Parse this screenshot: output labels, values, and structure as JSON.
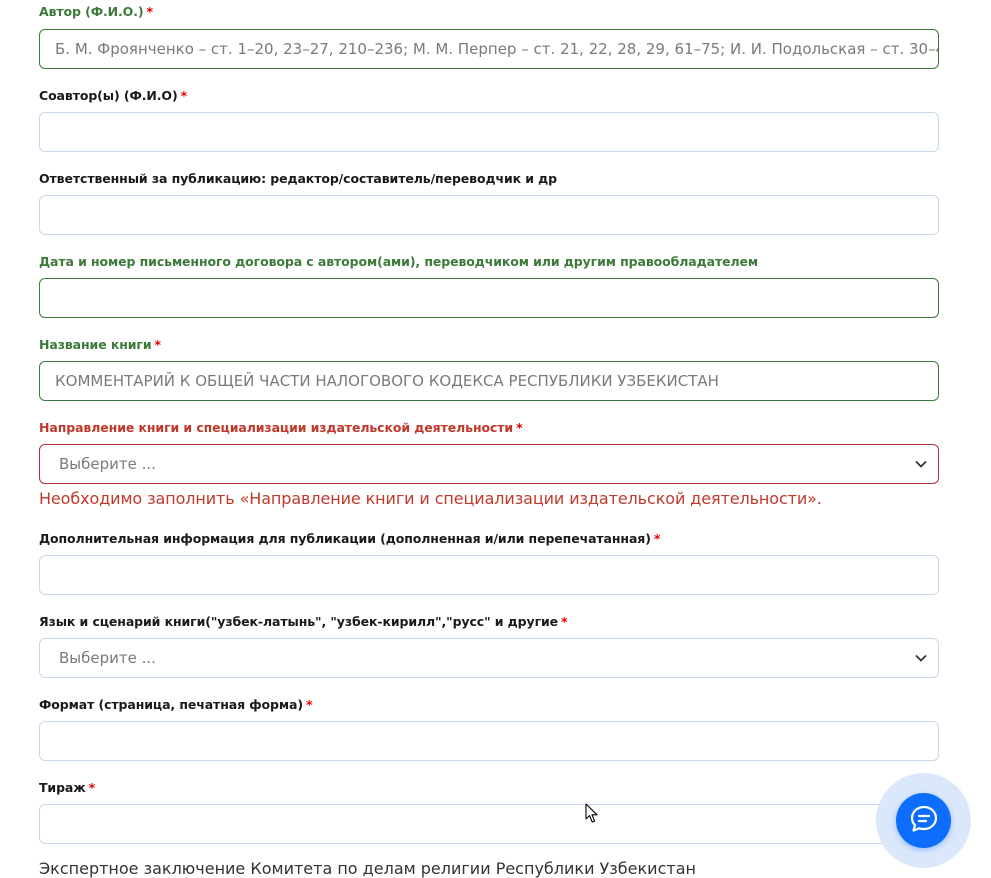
{
  "fields": [
    {
      "id": "author",
      "label": "Автор (Ф.И.О.)",
      "required": true,
      "state": "ok",
      "value": "Б. М. Фроянченко – ст. 1–20, 23–27, 210–236; М. М. Перпер – ст. 21, 22, 28, 29, 61–75; И. И. Подольская – ст. 30–4",
      "placeholder": ""
    },
    {
      "id": "coauthor",
      "label": "Соавтор(ы) (Ф.И.О)",
      "required": true,
      "state": "default",
      "value": "",
      "placeholder": ""
    },
    {
      "id": "responsible",
      "label": "Ответственный за публикацию: редактор/составитель/переводчик и др",
      "required": false,
      "state": "default",
      "value": "",
      "placeholder": ""
    },
    {
      "id": "contract",
      "label": "Дата и номер письменного договора с автором(ами), переводчиком или другим правообладателем",
      "required": false,
      "state": "ok",
      "value": "",
      "placeholder": ""
    },
    {
      "id": "book_title",
      "label": "Название книги",
      "required": true,
      "state": "ok",
      "value": "КОММЕНТАРИЙ К ОБЩЕЙ ЧАСТИ НАЛОГОВОГО КОДЕКСА РЕСПУБЛИКИ УЗБЕКИСТАН",
      "placeholder": ""
    },
    {
      "id": "direction",
      "label": "Направление книги и специализации издательской деятельности",
      "required": true,
      "state": "err",
      "value": "Выберите ...",
      "error": "Необходимо заполнить «Направление книги и специализации издательской деятельности»."
    },
    {
      "id": "additional",
      "label": "Дополнительная информация для публикации (дополненная и/или перепечатанная)",
      "required": true,
      "state": "default",
      "value": "",
      "placeholder": ""
    },
    {
      "id": "language",
      "label": "Язык и сценарий книги(\"узбек-латынь\", \"узбек-кирилл\",\"русс\" и другие",
      "required": true,
      "state": "default",
      "value": "Выберите ..."
    },
    {
      "id": "format",
      "label": "Формат (страница, печатная форма)",
      "required": true,
      "state": "default",
      "value": "",
      "placeholder": ""
    },
    {
      "id": "circulation",
      "label": "Тираж",
      "required": true,
      "state": "default",
      "value": "",
      "placeholder": ""
    }
  ],
  "required_mark": "*",
  "section_title": "Экспертное заключение Комитета по делам религии Республики Узбекистан",
  "colors": {
    "ok": "#3f7a3c",
    "error": "#b0313a",
    "chat": "#0d6efd",
    "border": "#c8d8ec"
  },
  "icons": {
    "chat": "chat-bubble-icon",
    "chevron": "chevron-down-icon",
    "cursor": "mouse-cursor-icon"
  }
}
